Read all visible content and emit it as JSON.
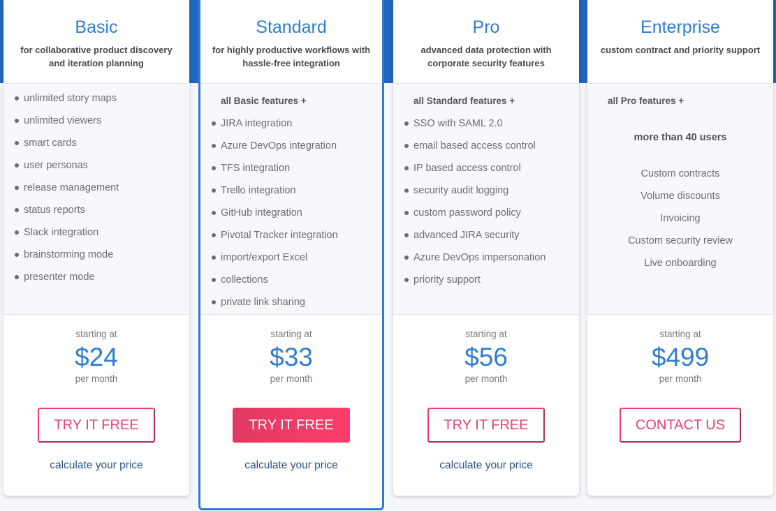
{
  "plans": [
    {
      "name": "Basic",
      "description": "for collaborative product discovery and iteration planning",
      "features_header": "",
      "features": [
        "unlimited story maps",
        "unlimited viewers",
        "smart cards",
        "user personas",
        "release management",
        "status reports",
        "Slack integration",
        "brainstorming mode",
        "presenter mode"
      ],
      "starting_label": "starting at",
      "price": "$24",
      "period": "per month",
      "cta_label": "TRY IT FREE",
      "calc_link": "calculate your price"
    },
    {
      "name": "Standard",
      "description": "for highly productive workflows with hassle-free integration",
      "features_header": "all Basic features +",
      "features": [
        "JIRA integration",
        "Azure DevOps integration",
        "TFS integration",
        "Trello integration",
        "GitHub integration",
        "Pivotal Tracker integration",
        "import/export Excel",
        "collections",
        "private link sharing"
      ],
      "starting_label": "starting at",
      "price": "$33",
      "period": "per month",
      "cta_label": "TRY IT FREE",
      "calc_link": "calculate your price",
      "featured": true
    },
    {
      "name": "Pro",
      "description": "advanced data protection with corporate security features",
      "features_header": "all Standard features +",
      "features": [
        "SSO with SAML 2.0",
        "email based access control",
        "IP based access control",
        "security audit logging",
        "custom password policy",
        "advanced JIRA security",
        "Azure DevOps impersonation",
        "priority support"
      ],
      "starting_label": "starting at",
      "price": "$56",
      "period": "per month",
      "cta_label": "TRY IT FREE",
      "calc_link": "calculate your price"
    },
    {
      "name": "Enterprise",
      "description": "custom contract and priority support",
      "features_header": "all Pro features +",
      "highlight": "more than 40 users",
      "features": [
        "Custom contracts",
        "Volume discounts",
        "Invoicing",
        "Custom security review",
        "Live onboarding"
      ],
      "starting_label": "starting at",
      "price": "$499",
      "period": "per month",
      "cta_label": "CONTACT US"
    }
  ],
  "colors": {
    "accent_blue": "#2f7dd3",
    "band_blue": "#1f67bd",
    "cta_pink": "#e8406a",
    "link_navy": "#2d5485"
  }
}
